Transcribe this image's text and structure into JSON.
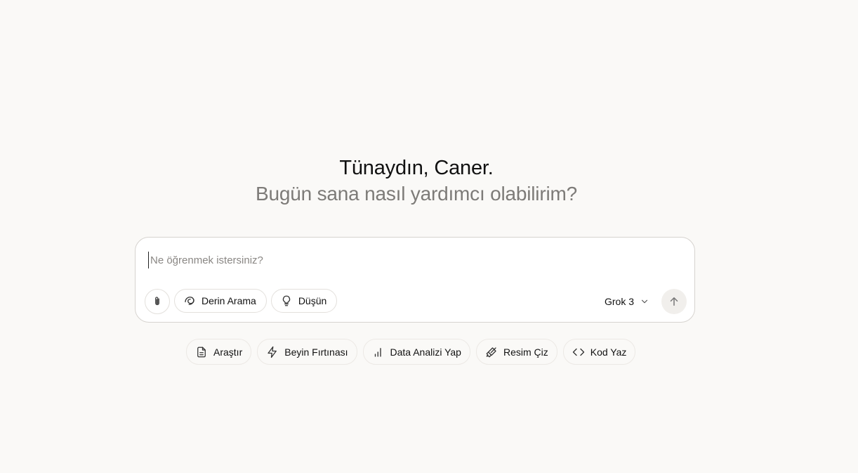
{
  "greeting": {
    "hello": "Tünaydın, Caner.",
    "sub": "Bugün sana nasıl yardımcı olabilirim?"
  },
  "composer": {
    "placeholder": "Ne öğrenmek istersiniz?",
    "value": "",
    "tools": [
      {
        "label": "Derin Arama",
        "icon": "deep-search-icon"
      },
      {
        "label": "Düşün",
        "icon": "lightbulb-icon"
      }
    ],
    "attach_icon": "paperclip-icon",
    "model": "Grok 3",
    "send_icon": "arrow-up-icon"
  },
  "suggestions": [
    {
      "label": "Araştır",
      "icon": "document-icon"
    },
    {
      "label": "Beyin Fırtınası",
      "icon": "lightning-icon"
    },
    {
      "label": "Data Analizi Yap",
      "icon": "bar-chart-icon"
    },
    {
      "label": "Resim Çiz",
      "icon": "brush-icon"
    },
    {
      "label": "Kod Yaz",
      "icon": "code-icon"
    }
  ],
  "colors": {
    "background": "#faf9f7",
    "subtext": "#7d7b78",
    "border": "#d6d3cf"
  }
}
